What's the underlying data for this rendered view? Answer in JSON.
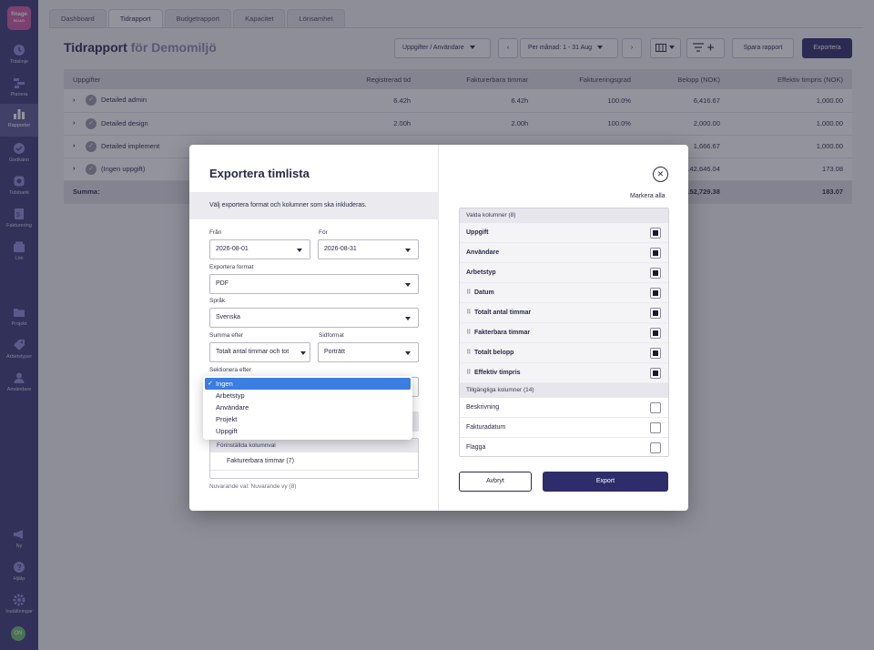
{
  "brand": {
    "logo_line1": "finage",
    "logo_line2": "BOAG",
    "color": "#d05aa0"
  },
  "sidebar": {
    "items": [
      {
        "label": "Tidslinje",
        "icon": "clock-icon"
      },
      {
        "label": "Planera",
        "icon": "plan-icon"
      },
      {
        "label": "Rapporter",
        "icon": "bar-chart-icon",
        "active": true
      },
      {
        "label": "Godkänn",
        "icon": "check-icon"
      },
      {
        "label": "Tidsbank",
        "icon": "bank-icon"
      },
      {
        "label": "Fakturering",
        "icon": "invoice-icon"
      },
      {
        "label": "Lön",
        "icon": "wallet-icon"
      },
      {
        "label": "Projekt",
        "icon": "folder-icon"
      },
      {
        "label": "Arbetstyper",
        "icon": "tag-icon"
      },
      {
        "label": "Användare",
        "icon": "user-icon"
      },
      {
        "label": "Ny",
        "icon": "megaphone-icon"
      },
      {
        "label": "Hjälp",
        "icon": "help-icon"
      },
      {
        "label": "Inställningar",
        "icon": "gear-icon"
      }
    ],
    "avatar": "ON"
  },
  "tabs": [
    "Dashboard",
    "Tidrapport",
    "Budgetrapport",
    "Kapacitet",
    "Lönsamhet"
  ],
  "active_tab": "Tidrapport",
  "header": {
    "title": "Tidrapport",
    "subtitle": "för Demomiljö",
    "group_select": "Uppgifter / Användare",
    "period_select": "Per månad: 1 - 31 Aug",
    "save_report": "Spara rapport",
    "export": "Exportera"
  },
  "table": {
    "columns": [
      "Uppgifter",
      "Registrerad tid",
      "Fakturerbara timmar",
      "Faktureringsgrad",
      "Belopp (NOK)",
      "Effektiv timpris (NOK)"
    ],
    "rows": [
      {
        "name": "Detailed admin",
        "registered": "6.42h",
        "billable": "6.42h",
        "rate": "100.0%",
        "amount": "6,416.67",
        "effective": "1,000.00"
      },
      {
        "name": "Detailed design",
        "registered": "2.00h",
        "billable": "2.00h",
        "rate": "100.0%",
        "amount": "2,000.00",
        "effective": "1,000.00"
      },
      {
        "name": "Detailed implement",
        "registered": "",
        "billable": "",
        "rate": "",
        "amount": "1,666.67",
        "effective": "1,000.00"
      },
      {
        "name": "(Ingen uppgift)",
        "registered": "",
        "billable": "",
        "rate": "",
        "amount": "142,646.04",
        "effective": "173.08"
      }
    ],
    "sum": {
      "label": "Summa:",
      "amount": "152,729.38",
      "effective": "183.07"
    }
  },
  "modal": {
    "title": "Exportera timlista",
    "description": "Välj exportera format och kolumner som ska inkluderas.",
    "from_label": "Från",
    "from_value": "2026-08-01",
    "to_label": "För",
    "to_value": "2026-08-31",
    "format_label": "Exportera format",
    "format_value": "PDF",
    "language_label": "Språk",
    "language_value": "Svenska",
    "sum_label": "Summa efter",
    "sum_value": "Totalt antal timmar och tot",
    "page_label": "Sidformat",
    "page_value": "Porträtt",
    "section_label": "Sektionera efter",
    "section_options": [
      "Ingen",
      "Arbetstyp",
      "Användare",
      "Projekt",
      "Uppgift"
    ],
    "section_selected": "Ingen",
    "preset_header": "Förinställda kolumnval",
    "preset_items": [
      "Fakturerbara timmar (7)"
    ],
    "current_view": "Nuvarande val: Nuvarande vy (8)",
    "mark_all": "Markera alla",
    "selected_header": "Valda kolumner (8)",
    "selected_columns": [
      {
        "label": "Uppgift",
        "drag": false
      },
      {
        "label": "Användare",
        "drag": false
      },
      {
        "label": "Arbetstyp",
        "drag": false
      },
      {
        "label": "Datum",
        "drag": true
      },
      {
        "label": "Totalt antal timmar",
        "drag": true
      },
      {
        "label": "Fakterbara timmar",
        "drag": true
      },
      {
        "label": "Totalt belopp",
        "drag": true
      },
      {
        "label": "Effektiv timpris",
        "drag": true
      }
    ],
    "available_header": "Tillgängliga kolumner (14)",
    "available_columns": [
      "Beskrivning",
      "Fakturadatum",
      "Flagga"
    ],
    "cancel": "Avbryt",
    "export": "Export"
  }
}
